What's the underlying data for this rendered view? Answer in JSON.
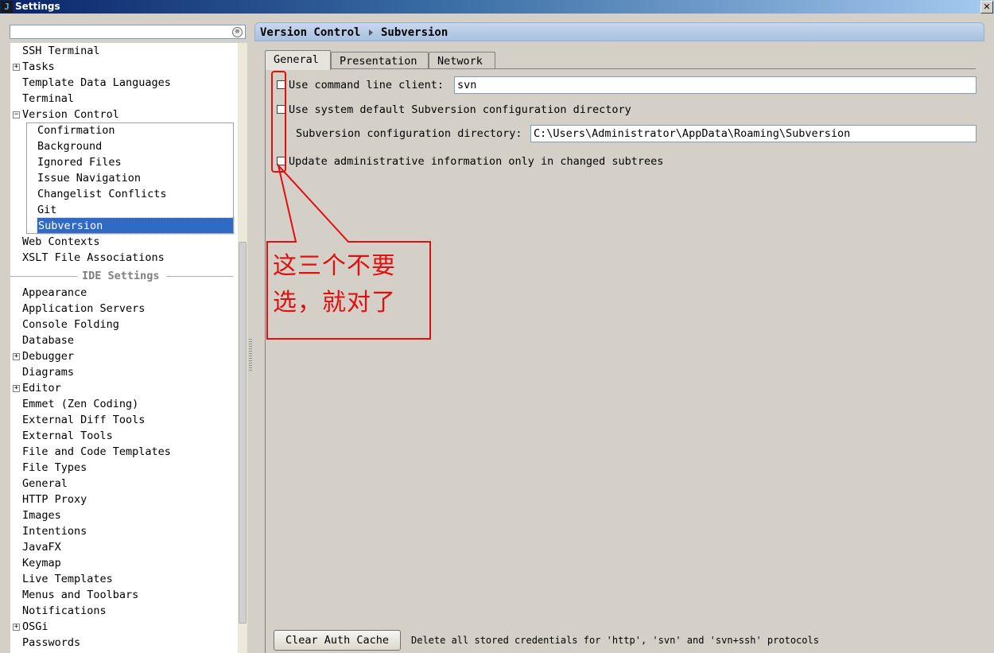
{
  "window": {
    "title": "Settings",
    "app_icon_glyph": "J",
    "close_glyph": "✕"
  },
  "search": {
    "value": "",
    "placeholder": "",
    "clear_glyph": "⊗"
  },
  "tree": {
    "top_items": [
      {
        "label": "SSH Terminal",
        "expander": ""
      },
      {
        "label": "Tasks",
        "expander": "+"
      },
      {
        "label": "Template Data Languages",
        "expander": ""
      },
      {
        "label": "Terminal",
        "expander": ""
      },
      {
        "label": "Version Control",
        "expander": "−"
      }
    ],
    "version_control_children": [
      "Confirmation",
      "Background",
      "Ignored Files",
      "Issue Navigation",
      "Changelist Conflicts",
      "Git",
      "Subversion"
    ],
    "selected_child": "Subversion",
    "after_items": [
      {
        "label": "Web Contexts",
        "expander": ""
      },
      {
        "label": "XSLT File Associations",
        "expander": ""
      }
    ],
    "ide_separator": "IDE Settings",
    "ide_items": [
      {
        "label": "Appearance",
        "expander": ""
      },
      {
        "label": "Application Servers",
        "expander": ""
      },
      {
        "label": "Console Folding",
        "expander": ""
      },
      {
        "label": "Database",
        "expander": ""
      },
      {
        "label": "Debugger",
        "expander": "+"
      },
      {
        "label": "Diagrams",
        "expander": ""
      },
      {
        "label": "Editor",
        "expander": "+"
      },
      {
        "label": "Emmet (Zen Coding)",
        "expander": ""
      },
      {
        "label": "External Diff Tools",
        "expander": ""
      },
      {
        "label": "External Tools",
        "expander": ""
      },
      {
        "label": "File and Code Templates",
        "expander": ""
      },
      {
        "label": "File Types",
        "expander": ""
      },
      {
        "label": "General",
        "expander": ""
      },
      {
        "label": "HTTP Proxy",
        "expander": ""
      },
      {
        "label": "Images",
        "expander": ""
      },
      {
        "label": "Intentions",
        "expander": ""
      },
      {
        "label": "JavaFX",
        "expander": ""
      },
      {
        "label": "Keymap",
        "expander": ""
      },
      {
        "label": "Live Templates",
        "expander": ""
      },
      {
        "label": "Menus and Toolbars",
        "expander": ""
      },
      {
        "label": "Notifications",
        "expander": ""
      },
      {
        "label": "OSGi",
        "expander": "+"
      },
      {
        "label": "Passwords",
        "expander": ""
      }
    ]
  },
  "header": {
    "crumb_parent": "Version Control",
    "crumb_current": "Subversion"
  },
  "tabs": [
    "General",
    "Presentation",
    "Network"
  ],
  "active_tab": "General",
  "general": {
    "use_cli": {
      "label": "Use command line client:",
      "checked": false,
      "value": "svn"
    },
    "use_default_dir": {
      "label": "Use system default Subversion configuration directory",
      "checked": false
    },
    "config_dir": {
      "label": "Subversion configuration directory:",
      "value": "C:\\Users\\Administrator\\AppData\\Roaming\\Subversion"
    },
    "update_admin": {
      "label": "Update administrative information only in changed subtrees",
      "checked": false
    },
    "clear_cache_button": "Clear Auth Cache",
    "clear_cache_note": "Delete all stored credentials for 'http', 'svn' and 'svn+ssh' protocols"
  },
  "annotation": {
    "line1": "这三个不要",
    "line2": "选，就对了",
    "color": "#e01010"
  }
}
